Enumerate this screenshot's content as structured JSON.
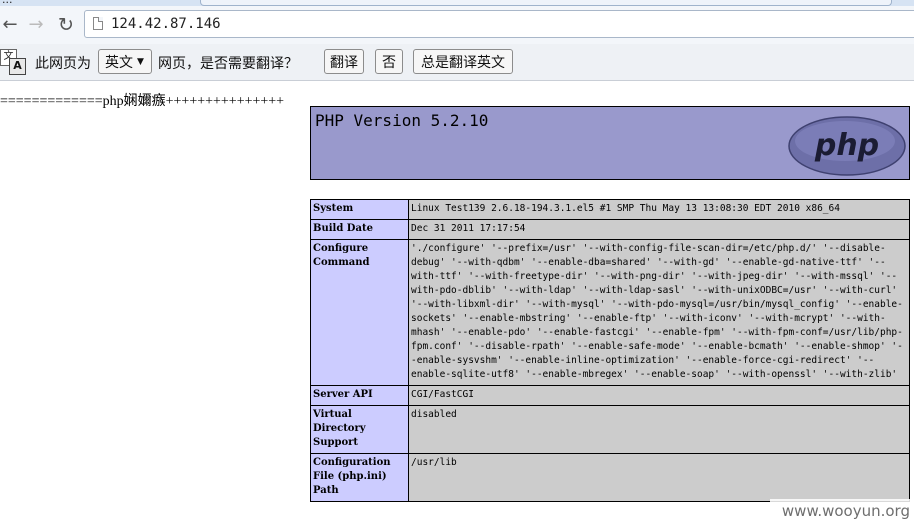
{
  "browser": {
    "tab_title_fragment": "...",
    "url": "124.42.87.146"
  },
  "translate_bar": {
    "icon_text_1": "文",
    "icon_text_2": "A",
    "prefix": "此网页为",
    "language": "英文",
    "suffix": "网页，是否需要翻译？",
    "translate_button": "翻译",
    "no_button": "否",
    "always_button": "总是翻译英文"
  },
  "page": {
    "debug_line": "=============php娴嬭瘯+++++++++++++++",
    "php_version_title": "PHP Version 5.2.10",
    "logo_text": "php",
    "rows": [
      {
        "label": "System",
        "value": "Linux Test139 2.6.18-194.3.1.el5 #1 SMP Thu May 13 13:08:30 EDT 2010 x86_64"
      },
      {
        "label": "Build Date",
        "value": "Dec 31 2011 17:17:54"
      },
      {
        "label": "Configure Command",
        "value": "'./configure' '--prefix=/usr' '--with-config-file-scan-dir=/etc/php.d/' '--disable-debug' '--with-qdbm' '--enable-dba=shared' '--with-gd' '--enable-gd-native-ttf' '--with-ttf' '--with-freetype-dir' '--with-png-dir' '--with-jpeg-dir' '--with-mssql' '--with-pdo-dblib' '--with-ldap' '--with-ldap-sasl' '--with-unixODBC=/usr' '--with-curl' '--with-libxml-dir' '--with-mysql' '--with-pdo-mysql=/usr/bin/mysql_config' '--enable-sockets' '--enable-mbstring' '--enable-ftp' '--with-iconv' '--with-mcrypt' '--with-mhash' '--enable-pdo' '--enable-fastcgi' '--enable-fpm' '--with-fpm-conf=/usr/lib/php-fpm.conf' '--disable-rpath' '--enable-safe-mode' '--enable-bcmath' '--enable-shmop' '--enable-sysvshm' '--enable-inline-optimization' '--enable-force-cgi-redirect' '--enable-sqlite-utf8' '--enable-mbregex' '--enable-soap' '--with-openssl' '--with-zlib'"
      },
      {
        "label": "Server API",
        "value": "CGI/FastCGI"
      },
      {
        "label": "Virtual Directory Support",
        "value": "disabled"
      },
      {
        "label": "Configuration File (php.ini) Path",
        "value": "/usr/lib"
      }
    ]
  },
  "watermark": "www.wooyun.org",
  "colors": {
    "header_bg": "#9999cc",
    "label_bg": "#ccccff",
    "value_bg": "#cccccc"
  }
}
